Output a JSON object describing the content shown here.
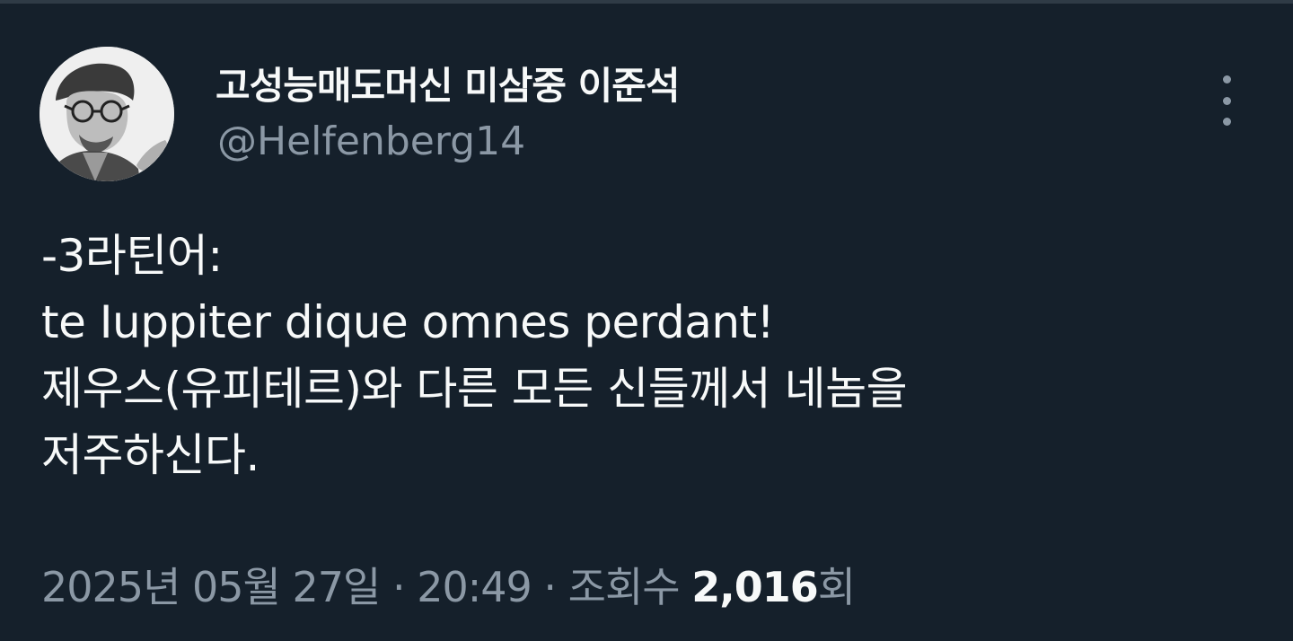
{
  "author": {
    "display_name": "고성능매도머신 미삼중 이준석",
    "handle": "@Helfenberg14"
  },
  "tweet": {
    "lines": [
      "-3라틴어:",
      "te Iuppiter dique omnes perdant!",
      "제우스(유피테르)와 다른 모든 신들께서 네놈을",
      "저주하신다."
    ]
  },
  "meta": {
    "date": "2025년 05월 27일",
    "separator1": " · ",
    "time": "20:49",
    "separator2": " · ",
    "views_label": "조회수 ",
    "views_count": "2,016",
    "views_suffix": "회"
  },
  "icons": {
    "more": "more-vertical-icon"
  },
  "colors": {
    "background": "#15202b",
    "primary_text": "#f7f9f9",
    "secondary_text": "#8b98a5"
  }
}
